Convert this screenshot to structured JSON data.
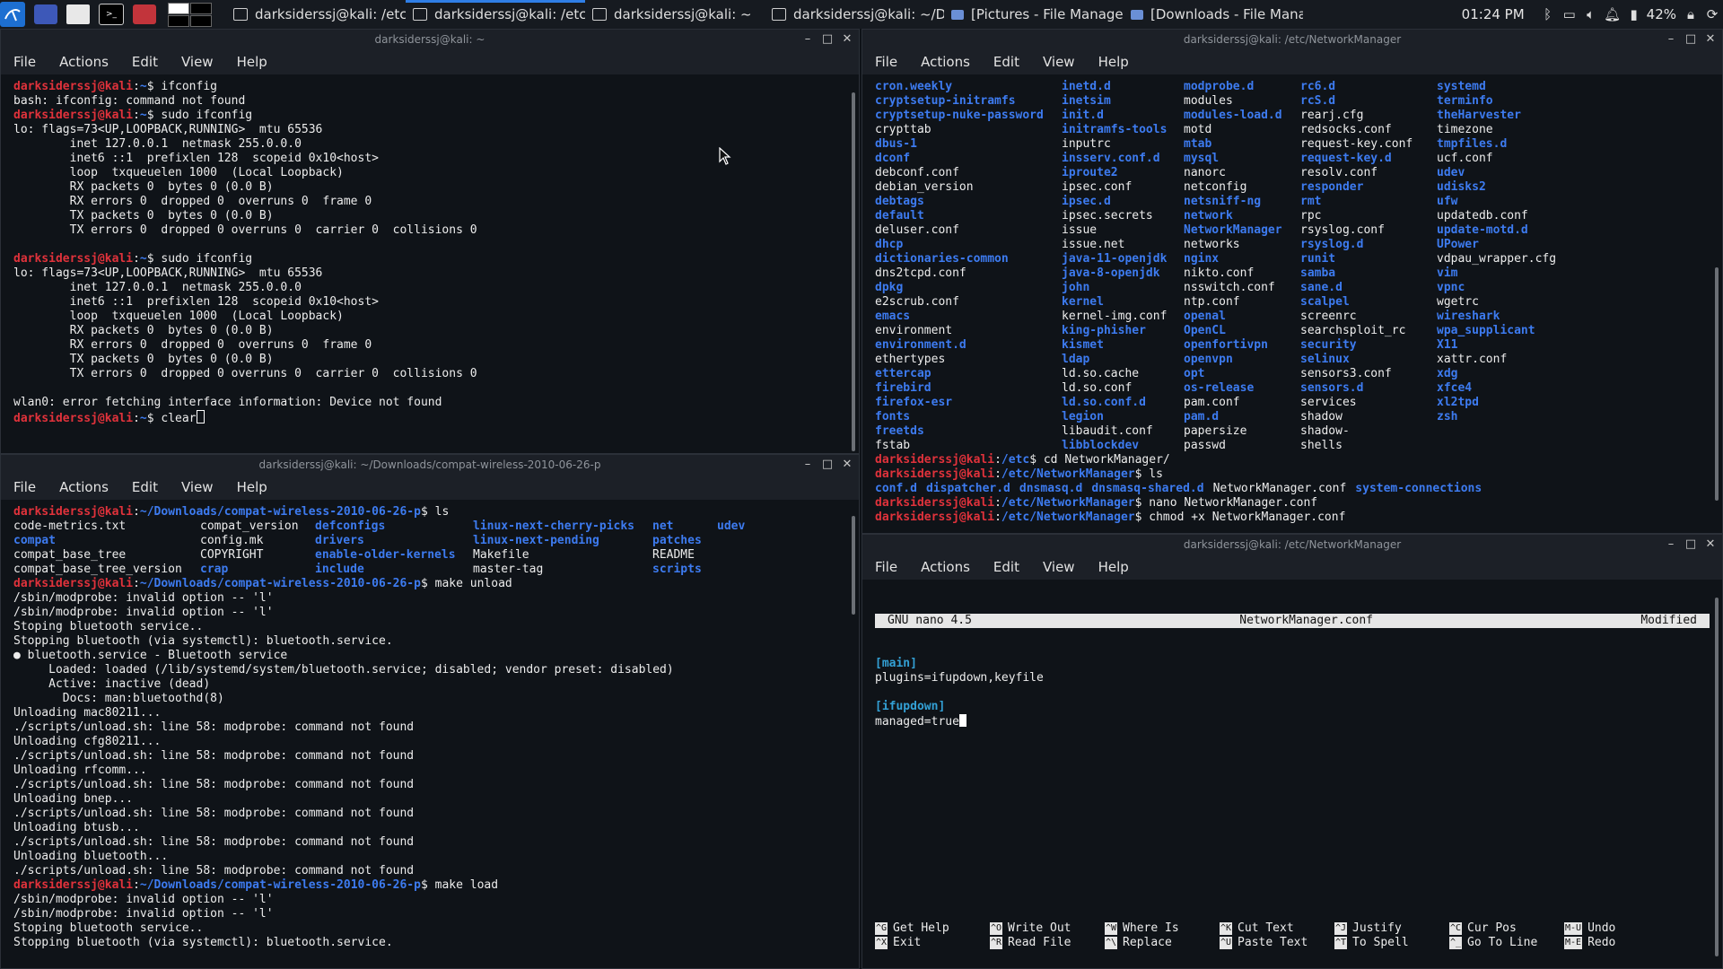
{
  "taskbar": {
    "tasks": [
      {
        "label": "darksiderssj@kali: /etc/...",
        "kind": "terminal",
        "active": false
      },
      {
        "label": "darksiderssj@kali: /etc/...",
        "kind": "terminal",
        "active": true
      },
      {
        "label": "darksiderssj@kali: ~",
        "kind": "terminal",
        "active": false
      },
      {
        "label": "darksiderssj@kali: ~/Do...",
        "kind": "terminal",
        "active": false
      },
      {
        "label": "[Pictures - File Manager]",
        "kind": "folder",
        "active": false
      },
      {
        "label": "[Downloads - File Mana...",
        "kind": "folder",
        "active": false
      }
    ],
    "clock": "01:24 PM",
    "battery": "42%"
  },
  "menu": [
    "File",
    "Actions",
    "Edit",
    "View",
    "Help"
  ],
  "win_home": {
    "title": "darksiderssj@kali: ~",
    "user": "darksiderssj@kali",
    "lines": [
      {
        "type": "prompt",
        "path": "~",
        "cmd": "ifconfig"
      },
      {
        "type": "out",
        "text": "bash: ifconfig: command not found"
      },
      {
        "type": "prompt",
        "path": "~",
        "cmd": "sudo ifconfig"
      },
      {
        "type": "out",
        "text": "lo: flags=73<UP,LOOPBACK,RUNNING>  mtu 65536"
      },
      {
        "type": "out",
        "text": "        inet 127.0.0.1  netmask 255.0.0.0"
      },
      {
        "type": "out",
        "text": "        inet6 ::1  prefixlen 128  scopeid 0x10<host>"
      },
      {
        "type": "out",
        "text": "        loop  txqueuelen 1000  (Local Loopback)"
      },
      {
        "type": "out",
        "text": "        RX packets 0  bytes 0 (0.0 B)"
      },
      {
        "type": "out",
        "text": "        RX errors 0  dropped 0  overruns 0  frame 0"
      },
      {
        "type": "out",
        "text": "        TX packets 0  bytes 0 (0.0 B)"
      },
      {
        "type": "out",
        "text": "        TX errors 0  dropped 0 overruns 0  carrier 0  collisions 0"
      },
      {
        "type": "out",
        "text": ""
      },
      {
        "type": "prompt",
        "path": "~",
        "cmd": "sudo ifconfig"
      },
      {
        "type": "out",
        "text": "lo: flags=73<UP,LOOPBACK,RUNNING>  mtu 65536"
      },
      {
        "type": "out",
        "text": "        inet 127.0.0.1  netmask 255.0.0.0"
      },
      {
        "type": "out",
        "text": "        inet6 ::1  prefixlen 128  scopeid 0x10<host>"
      },
      {
        "type": "out",
        "text": "        loop  txqueuelen 1000  (Local Loopback)"
      },
      {
        "type": "out",
        "text": "        RX packets 0  bytes 0 (0.0 B)"
      },
      {
        "type": "out",
        "text": "        RX errors 0  dropped 0  overruns 0  frame 0"
      },
      {
        "type": "out",
        "text": "        TX packets 0  bytes 0 (0.0 B)"
      },
      {
        "type": "out",
        "text": "        TX errors 0  dropped 0 overruns 0  carrier 0  collisions 0"
      },
      {
        "type": "out",
        "text": ""
      },
      {
        "type": "out",
        "text": "wlan0: error fetching interface information: Device not found"
      },
      {
        "type": "prompt",
        "path": "~",
        "cmd": "clear",
        "cursor": true
      }
    ]
  },
  "win_compat": {
    "title": "darksiderssj@kali: ~/Downloads/compat-wireless-2010-06-26-p",
    "user": "darksiderssj@kali",
    "path": "~/Downloads/compat-wireless-2010-06-26-p",
    "ls_cmd": "ls",
    "ls_rows": [
      [
        [
          "code-metrics.txt",
          "f"
        ],
        [
          "compat_version",
          "f"
        ],
        [
          "defconfigs",
          "d"
        ],
        [
          "linux-next-cherry-picks",
          "d"
        ],
        [
          "net",
          "d"
        ],
        [
          "udev",
          "d"
        ]
      ],
      [
        [
          "compat",
          "d"
        ],
        [
          "config.mk",
          "f"
        ],
        [
          "drivers",
          "d"
        ],
        [
          "linux-next-pending",
          "d"
        ],
        [
          "patches",
          "d"
        ],
        [
          "",
          "f"
        ]
      ],
      [
        [
          "compat_base_tree",
          "f"
        ],
        [
          "COPYRIGHT",
          "f"
        ],
        [
          "enable-older-kernels",
          "d"
        ],
        [
          "Makefile",
          "f"
        ],
        [
          "README",
          "f"
        ],
        [
          "",
          "f"
        ]
      ],
      [
        [
          "compat_base_tree_version",
          "f"
        ],
        [
          "crap",
          "d"
        ],
        [
          "include",
          "d"
        ],
        [
          "master-tag",
          "f"
        ],
        [
          "scripts",
          "d"
        ],
        [
          "",
          "f"
        ]
      ]
    ],
    "lines": [
      {
        "type": "prompt",
        "cmd": "make unload"
      },
      {
        "type": "out",
        "text": "/sbin/modprobe: invalid option -- 'l'"
      },
      {
        "type": "out",
        "text": "/sbin/modprobe: invalid option -- 'l'"
      },
      {
        "type": "out",
        "text": "Stoping bluetooth service.."
      },
      {
        "type": "out",
        "text": "Stopping bluetooth (via systemctl): bluetooth.service."
      },
      {
        "type": "out",
        "text": "● bluetooth.service - Bluetooth service"
      },
      {
        "type": "out",
        "text": "     Loaded: loaded (/lib/systemd/system/bluetooth.service; disabled; vendor preset: disabled)"
      },
      {
        "type": "out",
        "text": "     Active: inactive (dead)"
      },
      {
        "type": "out",
        "text": "       Docs: man:bluetoothd(8)"
      },
      {
        "type": "out",
        "text": "Unloading mac80211..."
      },
      {
        "type": "out",
        "text": "./scripts/unload.sh: line 58: modprobe: command not found"
      },
      {
        "type": "out",
        "text": "Unloading cfg80211..."
      },
      {
        "type": "out",
        "text": "./scripts/unload.sh: line 58: modprobe: command not found"
      },
      {
        "type": "out",
        "text": "Unloading rfcomm..."
      },
      {
        "type": "out",
        "text": "./scripts/unload.sh: line 58: modprobe: command not found"
      },
      {
        "type": "out",
        "text": "Unloading bnep..."
      },
      {
        "type": "out",
        "text": "./scripts/unload.sh: line 58: modprobe: command not found"
      },
      {
        "type": "out",
        "text": "Unloading btusb..."
      },
      {
        "type": "out",
        "text": "./scripts/unload.sh: line 58: modprobe: command not found"
      },
      {
        "type": "out",
        "text": "Unloading bluetooth..."
      },
      {
        "type": "out",
        "text": "./scripts/unload.sh: line 58: modprobe: command not found"
      },
      {
        "type": "prompt",
        "cmd": "make load"
      },
      {
        "type": "out",
        "text": "/sbin/modprobe: invalid option -- 'l'"
      },
      {
        "type": "out",
        "text": "/sbin/modprobe: invalid option -- 'l'"
      },
      {
        "type": "out",
        "text": "Stoping bluetooth service.."
      },
      {
        "type": "out",
        "text": "Stopping bluetooth (via systemctl): bluetooth.service."
      }
    ]
  },
  "win_etc": {
    "title": "darksiderssj@kali: /etc/NetworkManager",
    "user": "darksiderssj@kali",
    "ls_rows": [
      [
        [
          "cron.weekly",
          "d"
        ],
        [
          "inetd.d",
          "d"
        ],
        [
          "modprobe.d",
          "d"
        ],
        [
          "rc6.d",
          "d"
        ],
        [
          "systemd",
          "d"
        ]
      ],
      [
        [
          "cryptsetup-initramfs",
          "d"
        ],
        [
          "inetsim",
          "d"
        ],
        [
          "modules",
          "f"
        ],
        [
          "rcS.d",
          "d"
        ],
        [
          "terminfo",
          "d"
        ]
      ],
      [
        [
          "cryptsetup-nuke-password",
          "d"
        ],
        [
          "init.d",
          "d"
        ],
        [
          "modules-load.d",
          "d"
        ],
        [
          "rearj.cfg",
          "f"
        ],
        [
          "theHarvester",
          "d"
        ]
      ],
      [
        [
          "crypttab",
          "f"
        ],
        [
          "initramfs-tools",
          "d"
        ],
        [
          "motd",
          "f"
        ],
        [
          "redsocks.conf",
          "f"
        ],
        [
          "timezone",
          "f"
        ]
      ],
      [
        [
          "dbus-1",
          "d"
        ],
        [
          "inputrc",
          "f"
        ],
        [
          "mtab",
          "d"
        ],
        [
          "request-key.conf",
          "f"
        ],
        [
          "tmpfiles.d",
          "d"
        ]
      ],
      [
        [
          "dconf",
          "d"
        ],
        [
          "insserv.conf.d",
          "d"
        ],
        [
          "mysql",
          "d"
        ],
        [
          "request-key.d",
          "d"
        ],
        [
          "ucf.conf",
          "f"
        ]
      ],
      [
        [
          "debconf.conf",
          "f"
        ],
        [
          "iproute2",
          "d"
        ],
        [
          "nanorc",
          "f"
        ],
        [
          "resolv.conf",
          "f"
        ],
        [
          "udev",
          "d"
        ]
      ],
      [
        [
          "debian_version",
          "f"
        ],
        [
          "ipsec.conf",
          "f"
        ],
        [
          "netconfig",
          "f"
        ],
        [
          "responder",
          "d"
        ],
        [
          "udisks2",
          "d"
        ]
      ],
      [
        [
          "debtags",
          "d"
        ],
        [
          "ipsec.d",
          "d"
        ],
        [
          "netsniff-ng",
          "d"
        ],
        [
          "rmt",
          "d"
        ],
        [
          "ufw",
          "d"
        ]
      ],
      [
        [
          "default",
          "d"
        ],
        [
          "ipsec.secrets",
          "f"
        ],
        [
          "network",
          "d"
        ],
        [
          "rpc",
          "f"
        ],
        [
          "updatedb.conf",
          "f"
        ]
      ],
      [
        [
          "deluser.conf",
          "f"
        ],
        [
          "issue",
          "f"
        ],
        [
          "NetworkManager",
          "d"
        ],
        [
          "rsyslog.conf",
          "f"
        ],
        [
          "update-motd.d",
          "d"
        ]
      ],
      [
        [
          "dhcp",
          "d"
        ],
        [
          "issue.net",
          "f"
        ],
        [
          "networks",
          "f"
        ],
        [
          "rsyslog.d",
          "d"
        ],
        [
          "UPower",
          "d"
        ]
      ],
      [
        [
          "dictionaries-common",
          "d"
        ],
        [
          "java-11-openjdk",
          "d"
        ],
        [
          "nginx",
          "d"
        ],
        [
          "runit",
          "d"
        ],
        [
          "vdpau_wrapper.cfg",
          "f"
        ]
      ],
      [
        [
          "dns2tcpd.conf",
          "f"
        ],
        [
          "java-8-openjdk",
          "d"
        ],
        [
          "nikto.conf",
          "f"
        ],
        [
          "samba",
          "d"
        ],
        [
          "vim",
          "d"
        ]
      ],
      [
        [
          "dpkg",
          "d"
        ],
        [
          "john",
          "d"
        ],
        [
          "nsswitch.conf",
          "f"
        ],
        [
          "sane.d",
          "d"
        ],
        [
          "vpnc",
          "d"
        ]
      ],
      [
        [
          "e2scrub.conf",
          "f"
        ],
        [
          "kernel",
          "d"
        ],
        [
          "ntp.conf",
          "f"
        ],
        [
          "scalpel",
          "d"
        ],
        [
          "wgetrc",
          "f"
        ]
      ],
      [
        [
          "emacs",
          "d"
        ],
        [
          "kernel-img.conf",
          "f"
        ],
        [
          "openal",
          "d"
        ],
        [
          "screenrc",
          "f"
        ],
        [
          "wireshark",
          "d"
        ]
      ],
      [
        [
          "environment",
          "f"
        ],
        [
          "king-phisher",
          "d"
        ],
        [
          "OpenCL",
          "d"
        ],
        [
          "searchsploit_rc",
          "f"
        ],
        [
          "wpa_supplicant",
          "d"
        ]
      ],
      [
        [
          "environment.d",
          "d"
        ],
        [
          "kismet",
          "d"
        ],
        [
          "openfortivpn",
          "d"
        ],
        [
          "security",
          "d"
        ],
        [
          "X11",
          "d"
        ]
      ],
      [
        [
          "ethertypes",
          "f"
        ],
        [
          "ldap",
          "d"
        ],
        [
          "openvpn",
          "d"
        ],
        [
          "selinux",
          "d"
        ],
        [
          "xattr.conf",
          "f"
        ]
      ],
      [
        [
          "ettercap",
          "d"
        ],
        [
          "ld.so.cache",
          "f"
        ],
        [
          "opt",
          "d"
        ],
        [
          "sensors3.conf",
          "f"
        ],
        [
          "xdg",
          "d"
        ]
      ],
      [
        [
          "firebird",
          "d"
        ],
        [
          "ld.so.conf",
          "f"
        ],
        [
          "os-release",
          "d"
        ],
        [
          "sensors.d",
          "d"
        ],
        [
          "xfce4",
          "d"
        ]
      ],
      [
        [
          "firefox-esr",
          "d"
        ],
        [
          "ld.so.conf.d",
          "d"
        ],
        [
          "pam.conf",
          "f"
        ],
        [
          "services",
          "f"
        ],
        [
          "xl2tpd",
          "d"
        ]
      ],
      [
        [
          "fonts",
          "d"
        ],
        [
          "legion",
          "d"
        ],
        [
          "pam.d",
          "d"
        ],
        [
          "shadow",
          "f"
        ],
        [
          "zsh",
          "d"
        ]
      ],
      [
        [
          "freetds",
          "d"
        ],
        [
          "libaudit.conf",
          "f"
        ],
        [
          "papersize",
          "f"
        ],
        [
          "shadow-",
          "f"
        ],
        [
          "",
          "f"
        ]
      ],
      [
        [
          "fstab",
          "f"
        ],
        [
          "libblockdev",
          "d"
        ],
        [
          "passwd",
          "f"
        ],
        [
          "shells",
          "f"
        ],
        [
          "",
          "f"
        ]
      ]
    ],
    "tail": [
      {
        "path": "/etc",
        "cmd": "cd NetworkManager/"
      },
      {
        "path": "/etc/NetworkManager",
        "cmd": "ls"
      },
      {
        "ls2": [
          [
            "conf.d",
            "d"
          ],
          [
            "dispatcher.d",
            "d"
          ],
          [
            "dnsmasq.d",
            "d"
          ],
          [
            "dnsmasq-shared.d",
            "d"
          ],
          [
            "NetworkManager.conf",
            "f"
          ],
          [
            "system-connections",
            "d"
          ]
        ]
      },
      {
        "path": "/etc/NetworkManager",
        "cmd": "nano NetworkManager.conf"
      },
      {
        "path": "/etc/NetworkManager",
        "cmd": "chmod +x NetworkManager.conf"
      }
    ]
  },
  "win_nano": {
    "title": "darksiderssj@kali: /etc/NetworkManager",
    "version": "GNU nano 4.5",
    "filename": "NetworkManager.conf",
    "status": "Modified",
    "content": [
      {
        "text": "[main]",
        "section": true
      },
      {
        "text": "plugins=ifupdown,keyfile",
        "section": false
      },
      {
        "text": "",
        "section": false
      },
      {
        "text": "[ifupdown]",
        "section": true
      },
      {
        "text": "managed=true",
        "section": false,
        "cursor": true
      }
    ],
    "help": [
      [
        [
          "^G",
          "Get Help"
        ],
        [
          "^O",
          "Write Out"
        ],
        [
          "^W",
          "Where Is"
        ],
        [
          "^K",
          "Cut Text"
        ],
        [
          "^J",
          "Justify"
        ],
        [
          "^C",
          "Cur Pos"
        ],
        [
          "M-U",
          "Undo"
        ]
      ],
      [
        [
          "^X",
          "Exit"
        ],
        [
          "^R",
          "Read File"
        ],
        [
          "^\\",
          "Replace"
        ],
        [
          "^U",
          "Paste Text"
        ],
        [
          "^T",
          "To Spell"
        ],
        [
          "^_",
          "Go To Line"
        ],
        [
          "M-E",
          "Redo"
        ]
      ]
    ]
  }
}
